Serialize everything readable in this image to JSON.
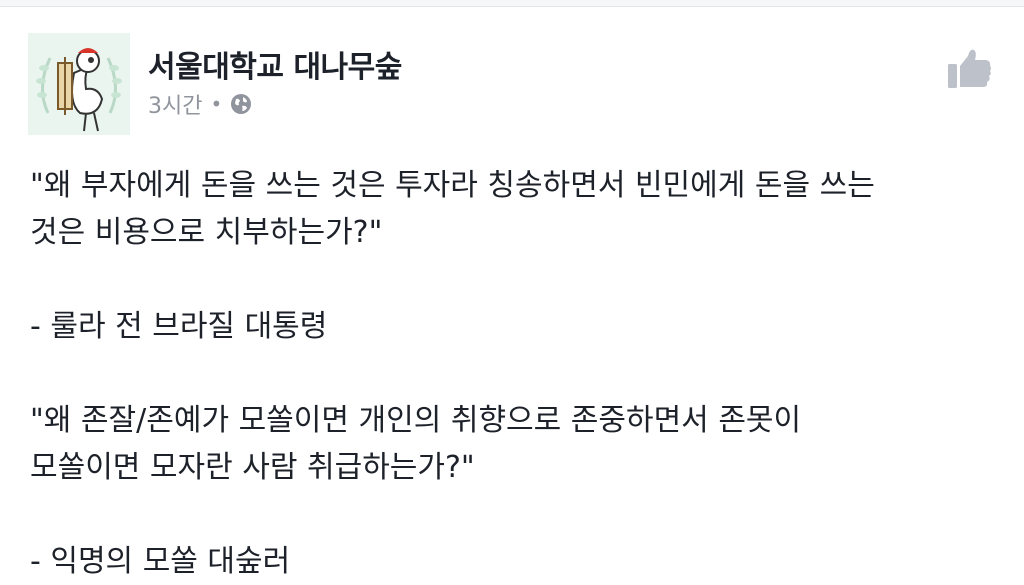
{
  "post": {
    "page_name": "서울대학교 대나무숲",
    "timestamp": "3시간",
    "separator": "•",
    "privacy_icon": "globe-icon",
    "like_icon": "thumbs-up-icon",
    "lines": [
      "\"왜 부자에게 돈을 쓰는 것은 투자라 칭송하면서 빈민에게 돈을 쓰는",
      "것은 비용으로 치부하는가?\"",
      "",
      "- 룰라 전 브라질 대통령",
      "",
      "\"왜 존잘/존예가 모쏠이면 개인의 취향으로 존중하면서 존못이",
      "모쏠이면 모자란 사람 취급하는가?\"",
      "",
      "- 익명의 모쏠 대숲러"
    ]
  },
  "colors": {
    "text": "#1d2129",
    "meta_text": "#90949c",
    "like_icon": "#bdc1c9",
    "avatar_bg": "#eaf5f0"
  }
}
